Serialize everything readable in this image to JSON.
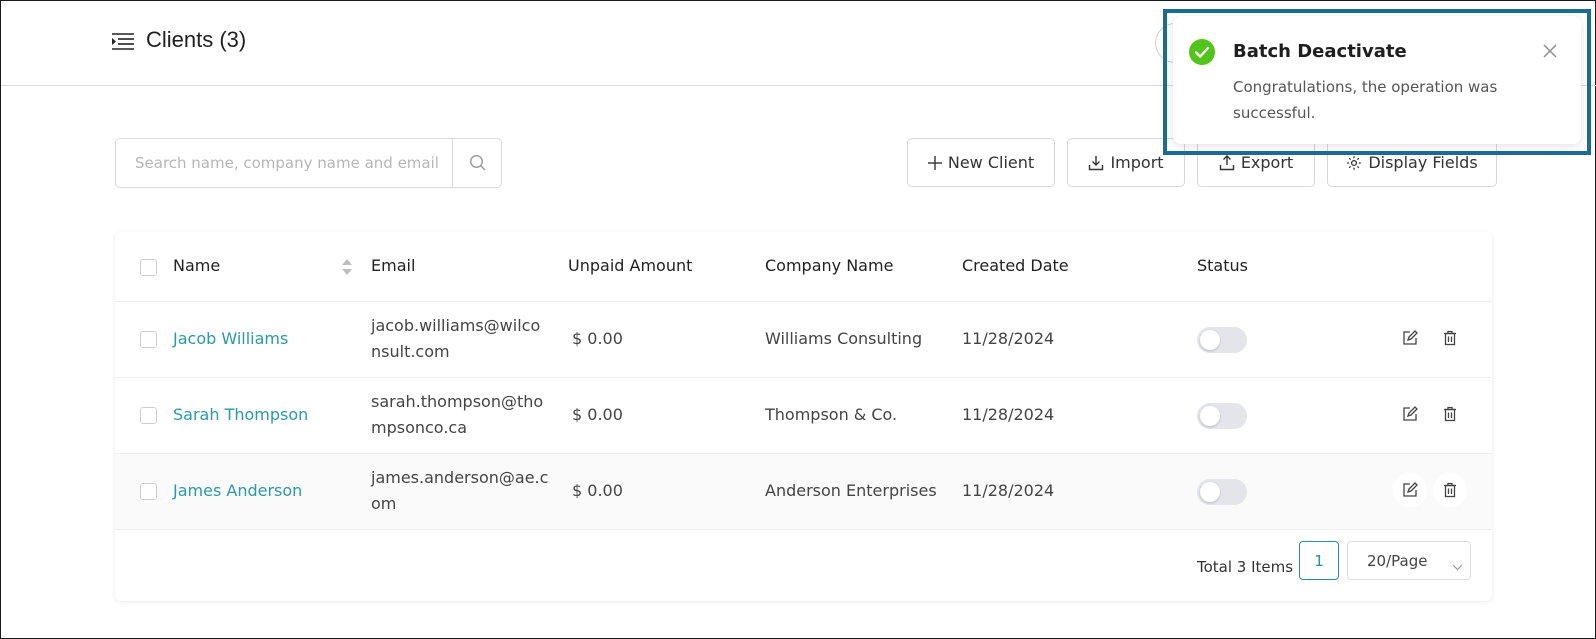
{
  "header": {
    "title": "Clients (3)"
  },
  "toolbar": {
    "search_placeholder": "Search name, company name and email",
    "new_client": "New Client",
    "import": "Import",
    "export": "Export",
    "display_fields": "Display Fields"
  },
  "table": {
    "columns": [
      "Name",
      "Email",
      "Unpaid Amount",
      "Company Name",
      "Created Date",
      "Status"
    ],
    "rows": [
      {
        "name": "Jacob Williams",
        "email": "jacob.williams@wilconsult.com",
        "unpaid": "$ 0.00",
        "company": "Williams Consulting",
        "created": "11/28/2024",
        "status_active": false
      },
      {
        "name": "Sarah Thompson",
        "email": "sarah.thompson@thompsonco.ca",
        "unpaid": "$ 0.00",
        "company": "Thompson & Co.",
        "created": "11/28/2024",
        "status_active": false
      },
      {
        "name": "James Anderson",
        "email": "james.anderson@ae.com",
        "unpaid": "$ 0.00",
        "company": "Anderson Enterprises",
        "created": "11/28/2024",
        "status_active": false
      }
    ]
  },
  "pagination": {
    "total": "Total 3 Items",
    "current_page": "1",
    "page_size": "20/Page"
  },
  "notification": {
    "title": "Batch Deactivate",
    "message": "Congratulations, the operation was successful."
  },
  "colors": {
    "accent": "#2a9aa6",
    "success": "#52c41a",
    "highlight_outline": "#1d6a93"
  }
}
